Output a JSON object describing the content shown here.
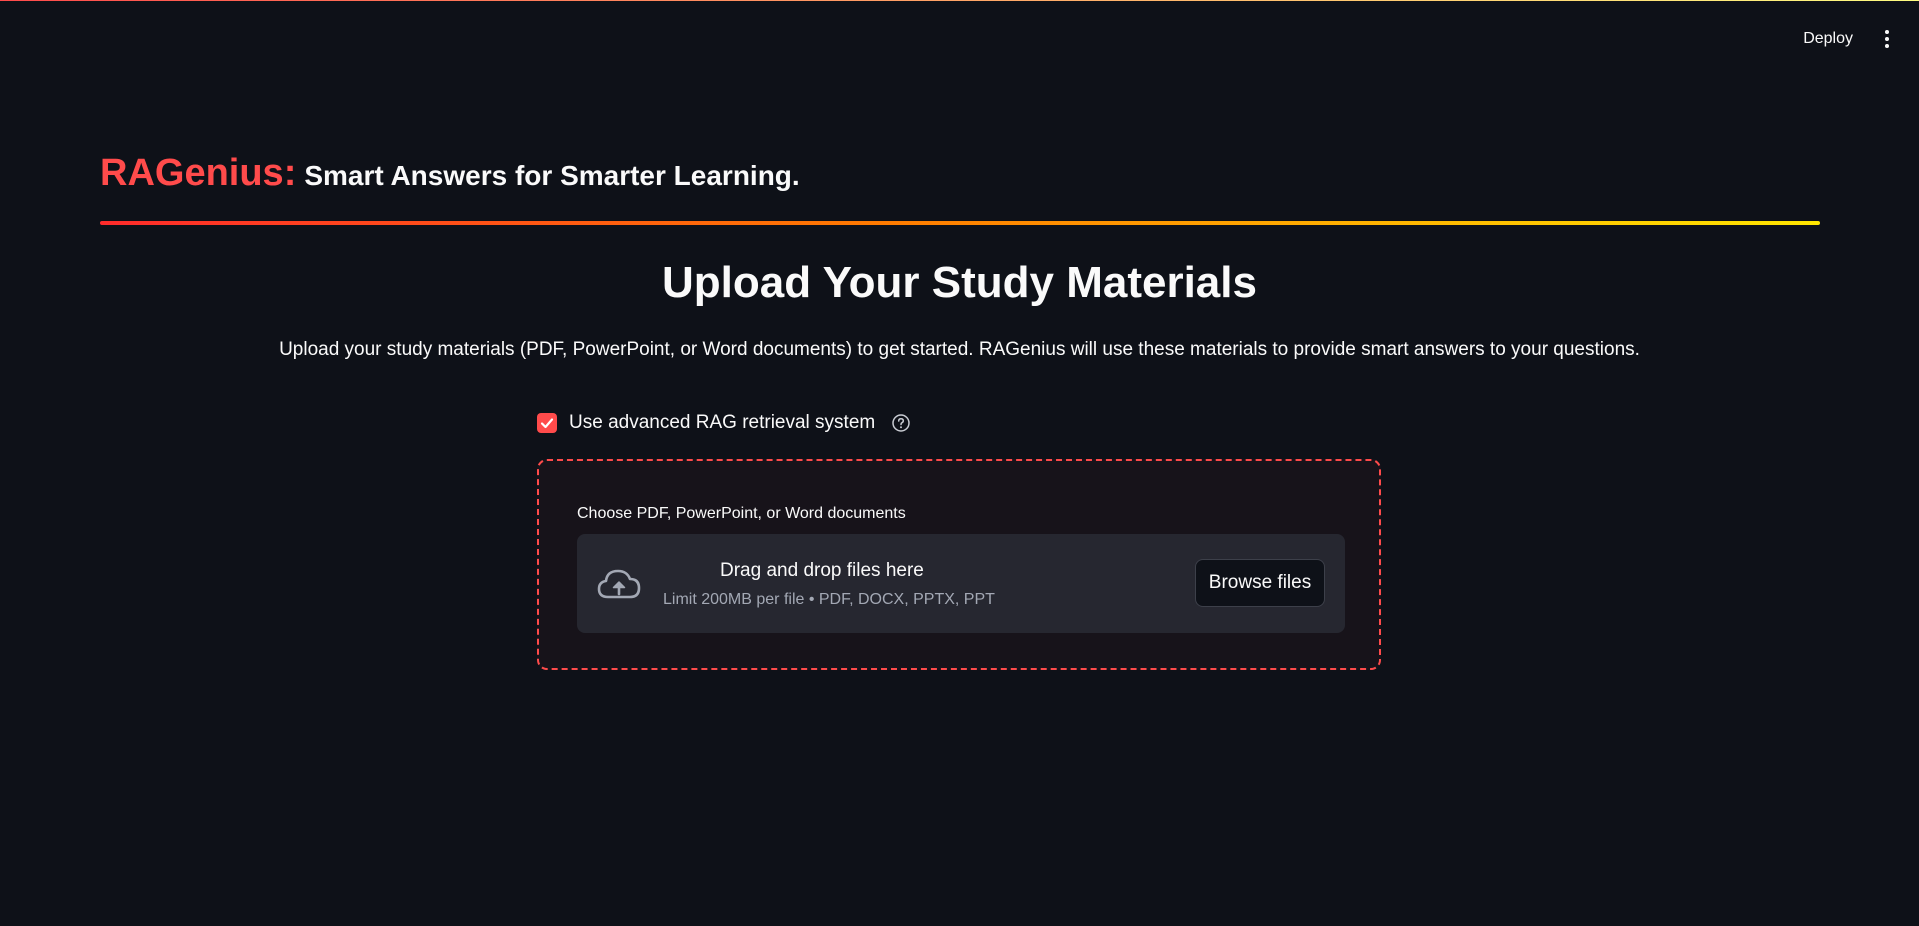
{
  "topbar": {
    "deploy_label": "Deploy",
    "menu_icon": "vertical-dots-icon"
  },
  "header": {
    "brand": "RAGenius:",
    "tagline": "Smart Answers for Smarter Learning."
  },
  "main": {
    "title": "Upload Your Study Materials",
    "intro": "Upload your study materials (PDF, PowerPoint, or Word documents) to get started. RAGenius will use these materials to provide smart answers to your questions.",
    "rag_option": {
      "label": "Use advanced RAG retrieval system",
      "checked": true,
      "help_icon": "question-circle-icon"
    },
    "uploader": {
      "label": "Choose PDF, PowerPoint, or Word documents",
      "drop_title": "Drag and drop files here",
      "limit_text": "Limit 200MB per file • PDF, DOCX, PPTX, PPT",
      "browse_label": "Browse files",
      "icon": "cloud-upload-icon"
    }
  },
  "colors": {
    "background": "#0e1118",
    "accent": "#ff4b4b",
    "dropzone": "#262730",
    "muted_text": "#a3a8b4",
    "gradient_start": "#ff2b2b",
    "gradient_end": "#ffe600"
  }
}
